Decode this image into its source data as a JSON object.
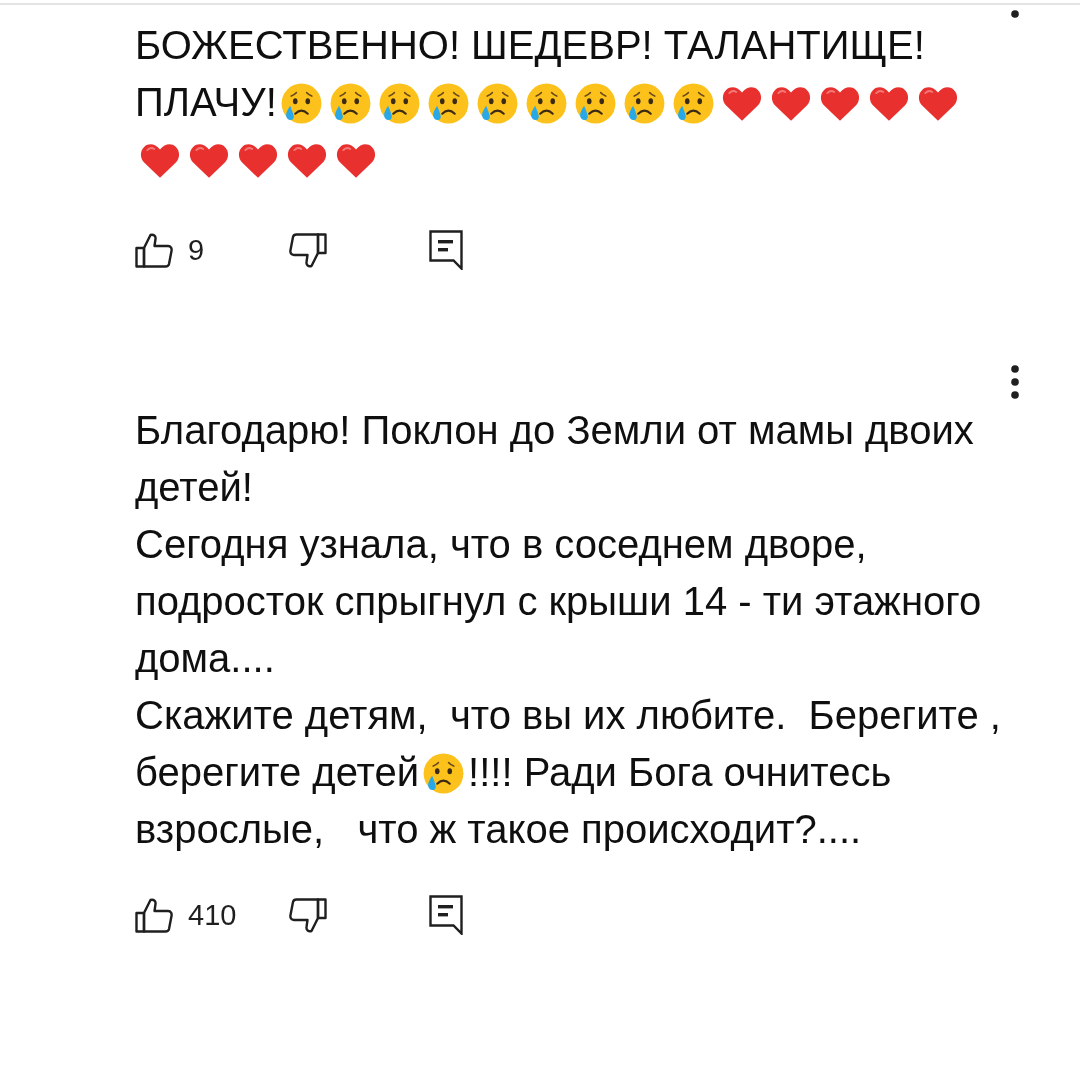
{
  "comments": [
    {
      "paragraphs": [
        [
          {
            "kind": "text",
            "text": "БОЖЕСТВЕННО! ШЕДЕВР! ТАЛАНТИЩЕ! ПЛАЧУ!"
          },
          {
            "kind": "crying"
          },
          {
            "kind": "crying"
          },
          {
            "kind": "crying"
          },
          {
            "kind": "crying"
          },
          {
            "kind": "crying"
          },
          {
            "kind": "crying"
          },
          {
            "kind": "crying"
          },
          {
            "kind": "crying"
          },
          {
            "kind": "crying"
          },
          {
            "kind": "heart"
          },
          {
            "kind": "heart"
          },
          {
            "kind": "heart"
          },
          {
            "kind": "heart"
          },
          {
            "kind": "heart"
          },
          {
            "kind": "heart"
          },
          {
            "kind": "heart"
          },
          {
            "kind": "heart"
          },
          {
            "kind": "heart"
          },
          {
            "kind": "heart"
          }
        ]
      ],
      "likes": "9"
    },
    {
      "paragraphs": [
        [
          {
            "kind": "text",
            "text": "Благодарю! Поклон до Земли от мамы двоих детей!"
          }
        ],
        [
          {
            "kind": "text",
            "text": "Сегодня узнала, что в соседнем дворе, подросток спрыгнул с крыши 14 - ти этажного дома...."
          }
        ],
        [
          {
            "kind": "text",
            "text": "Скажите детям,  что вы их любите.  Берегите , берегите детей"
          },
          {
            "kind": "crying"
          },
          {
            "kind": "text",
            "text": "!!!! Ради Бога очнитесь взрослые,   что ж такое происходит?...."
          }
        ]
      ],
      "likes": "410"
    }
  ]
}
